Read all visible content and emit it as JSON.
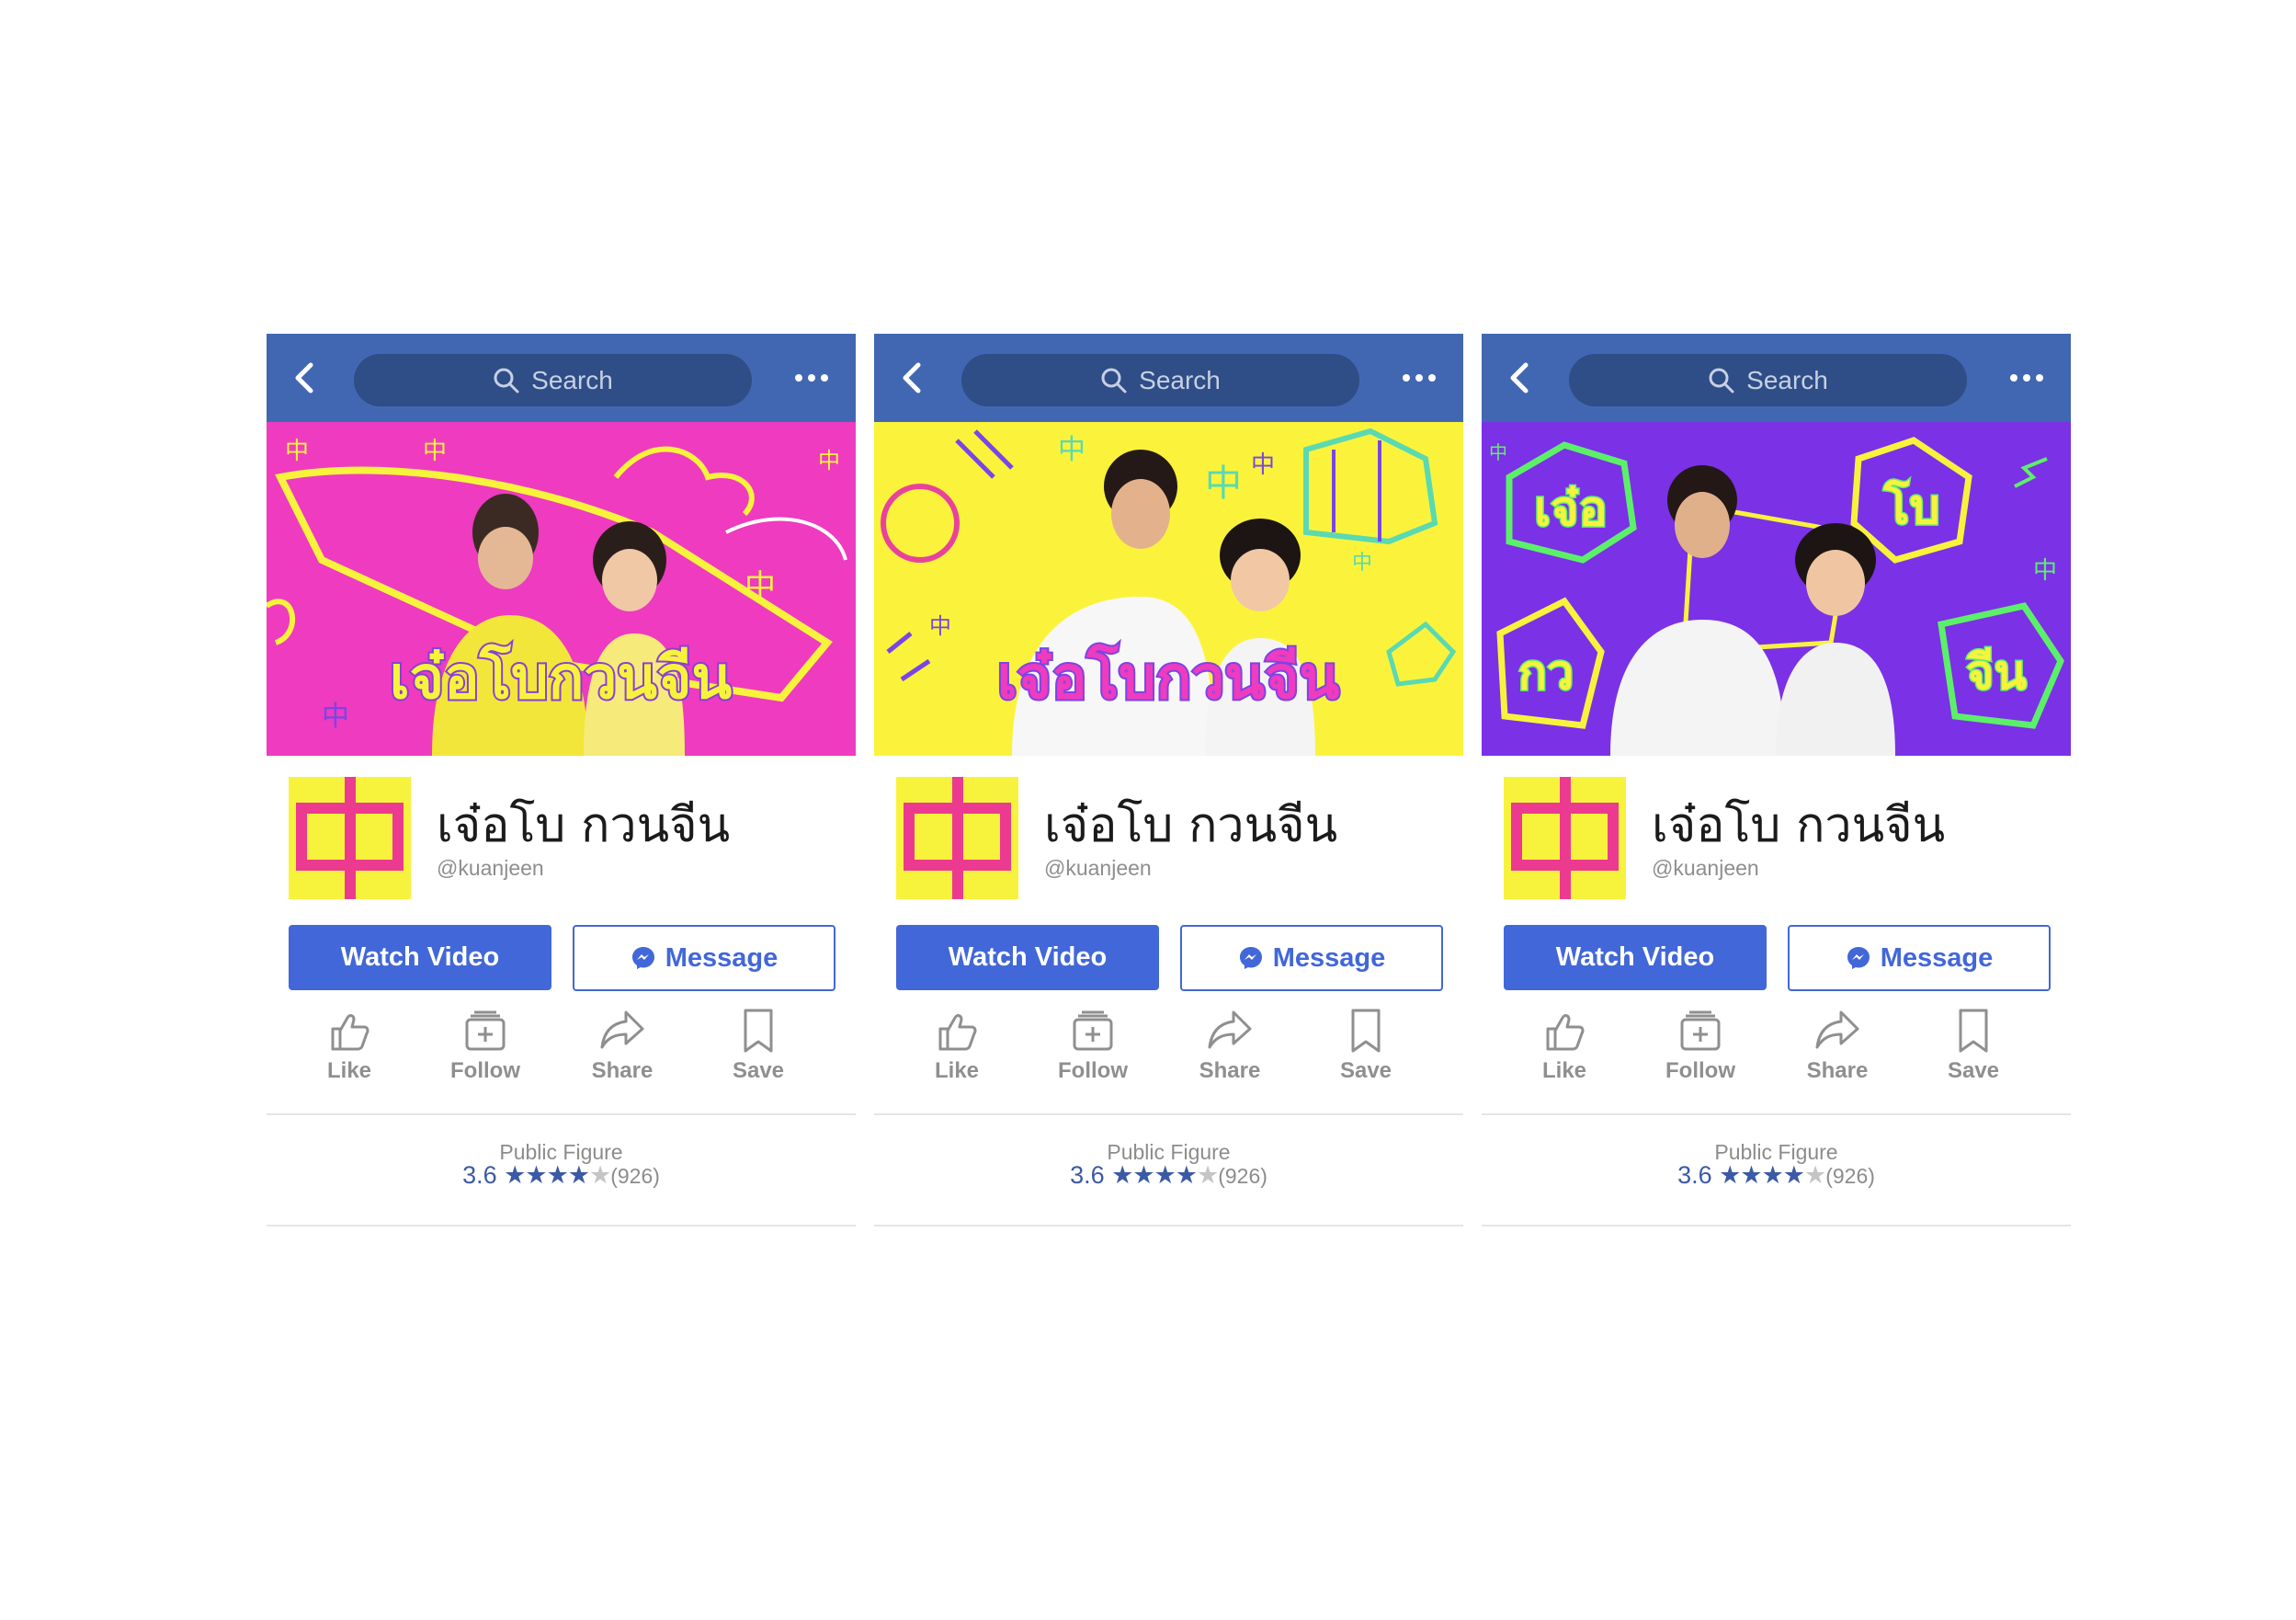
{
  "colors": {
    "header": "#4267b2",
    "button": "#4267d8",
    "cover_1": "#ee3bbf",
    "cover_2": "#fbf33b",
    "cover_3": "#7b31e6"
  },
  "search": {
    "placeholder": "Search"
  },
  "page": {
    "name": "เจ๋อโบ กวนจีน",
    "handle": "@kuanjeen",
    "logo_char": "中",
    "cover_title": "เจ๋อโบกวนจีน",
    "cover3_words": [
      "เจ๋อ",
      "โบ",
      "กว",
      "จีน"
    ]
  },
  "buttons": {
    "watch": "Watch Video",
    "message": "Message"
  },
  "actions": {
    "like": "Like",
    "follow": "Follow",
    "share": "Share",
    "save": "Save"
  },
  "info": {
    "category": "Public Figure",
    "rating": "3.6",
    "stars_filled": "★★★★",
    "stars_empty": "★",
    "reviews": "(926)"
  },
  "icons": [
    "back-arrow-icon",
    "search-icon",
    "more-icon",
    "messenger-icon",
    "like-icon",
    "follow-icon",
    "share-icon",
    "save-icon",
    "star-icon"
  ]
}
